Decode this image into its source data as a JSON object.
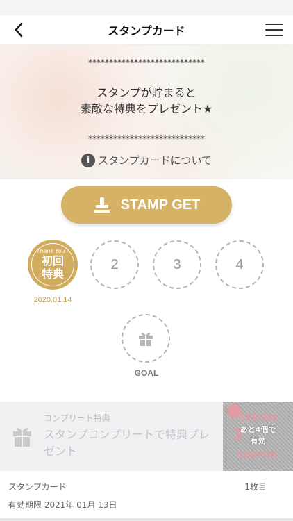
{
  "header": {
    "title": "スタンプカード"
  },
  "hero": {
    "stars_top": "****************************",
    "message_line1": "スタンプが貯まると",
    "message_line2": "素敵な特典をプレゼント★",
    "stars_bottom": "****************************",
    "about_link": "スタンプカードについて",
    "info_icon_glyph": "i"
  },
  "stamp_button": {
    "label": "STAMP GET"
  },
  "stamps": {
    "first": {
      "arc_text": "Thank You !",
      "line1": "初回",
      "line2": "特典",
      "date": "2020.01.14"
    },
    "slots": [
      "2",
      "3",
      "4"
    ],
    "goal_label": "GOAL"
  },
  "complete_bonus": {
    "label": "コンプリート特典",
    "description": "スタンプコンプリートで特典プレゼント",
    "coupon": {
      "special": "SPECIAL",
      "off": "3",
      "coupon_text": "COUPON",
      "remaining_line1": "あと4個で",
      "remaining_line2": "有効"
    }
  },
  "footer": {
    "card_label": "スタンプカード",
    "card_count": "1枚目",
    "expiry": "有効期限 2021年 01月 13日"
  },
  "colors": {
    "gold": "#d5b266",
    "gold_text": "#c9a457",
    "pink": "#e39aa4"
  },
  "icons": {
    "back": "chevron-left-icon",
    "menu": "hamburger-menu-icon",
    "info": "info-icon",
    "stamp": "stamp-icon",
    "gift": "gift-icon"
  }
}
